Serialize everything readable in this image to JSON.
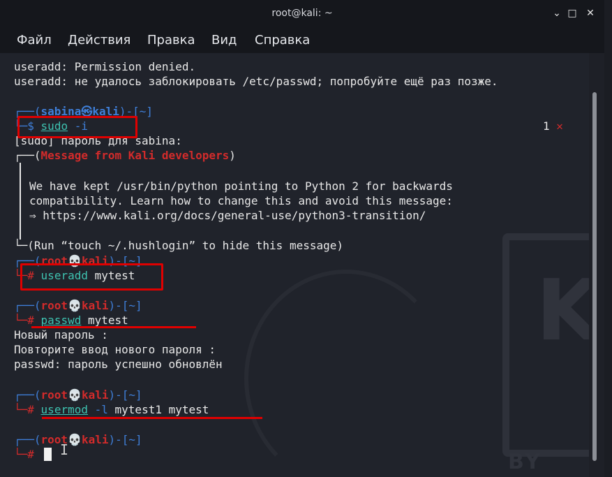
{
  "window": {
    "title": "root@kali: ~",
    "minimize": "⌄",
    "maximize": "□",
    "close": "✕"
  },
  "menu": [
    "Файл",
    "Действия",
    "Правка",
    "Вид",
    "Справка"
  ],
  "term": {
    "l1": "useradd: Permission denied.",
    "l2": "useradd: не удалось заблокировать /etc/passwd; попробуйте ещё раз позже.",
    "p1_open": "┌──(",
    "p1_user": "sabina",
    "p1_sep": "㉿",
    "p1_host": "kali",
    "p1_close": ")-[~]",
    "p1_mark": "└─$",
    "p1_cmd": "sudo",
    "p1_arg": "-i",
    "badge_count": "1",
    "badge_icon": "✕",
    "sudo_prompt": "[sudo] пароль для sabina:",
    "msg_head_open": "┌──(",
    "msg_title": "Message from Kali developers",
    "msg_head_close": ")",
    "msg1": "We have kept /usr/bin/python pointing to Python 2 for backwards",
    "msg2": "compatibility. Learn how to change this and avoid this message:",
    "msg3": "⇒ https://www.kali.org/docs/general-use/python3-transition/",
    "msg_foot": "└─(Run “touch ~/.hushlogin” to hide this message)",
    "root_user": "root",
    "root_sep": "💀",
    "root_host": "kali",
    "root_close": ")-[~]",
    "root_open": "┌──(",
    "root_mark": "└─#",
    "c2_cmd": "useradd",
    "c2_arg": "mytest",
    "c3_cmd": "passwd",
    "c3_arg": "mytest",
    "out1": "Новый пароль :",
    "out2": "Повторите ввод нового пароля :",
    "out3": "passwd: пароль успешно обновлён",
    "c4_cmd": "usermod",
    "c4_flag": "-l",
    "c4_arg": "mytest1 mytest"
  },
  "watermark": {
    "letter": "K",
    "text": "BY OFFE"
  },
  "colors": {
    "accent_blue": "#3f7fd9",
    "root_red": "#d22b2b",
    "command_cyan": "#3ec2b0",
    "highlight_red": "#e00000"
  }
}
